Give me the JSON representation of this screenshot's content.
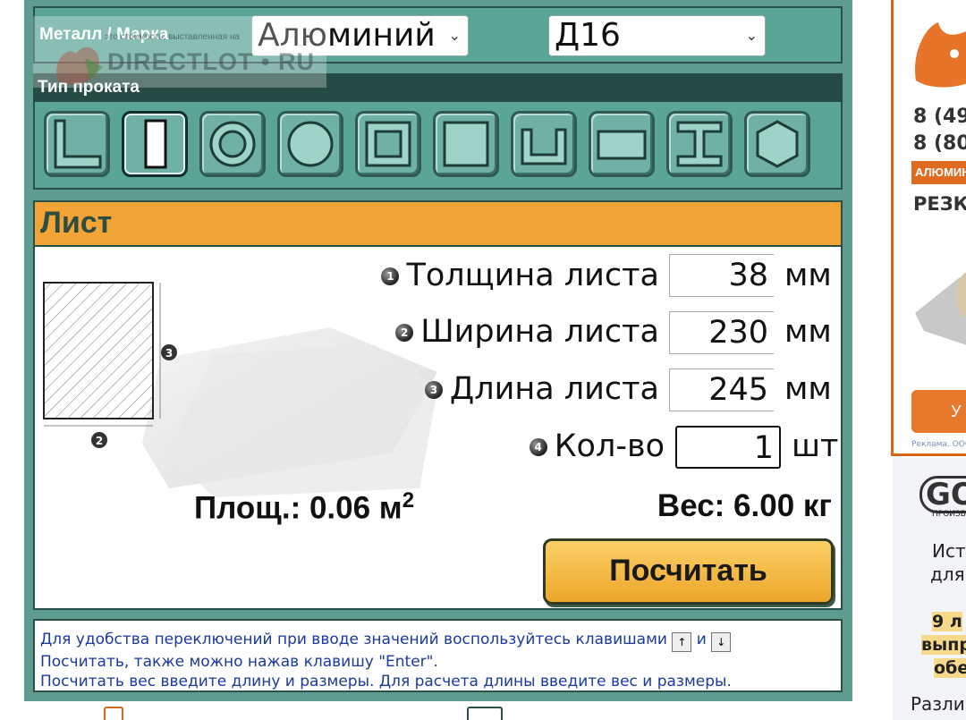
{
  "metal": {
    "label": "Металл / Марка",
    "metal_value": "Алюминий",
    "grade_value": "Д16"
  },
  "watermark": {
    "site": "DIRECTLOT • RU",
    "note": "это стоимость, выставленная на"
  },
  "profile": {
    "label": "Тип проката",
    "shapes": [
      "angle-icon",
      "sheet-icon",
      "pipe-icon",
      "round-bar-icon",
      "square-pipe-icon",
      "square-bar-icon",
      "channel-icon",
      "flat-bar-icon",
      "i-beam-icon",
      "hexagon-icon"
    ],
    "active_index": 1
  },
  "calculator": {
    "title": "Лист",
    "params": [
      {
        "num": "1",
        "label": "Толщина листа",
        "value": "38",
        "unit": "мм"
      },
      {
        "num": "2",
        "label": "Ширина листа",
        "value": "230",
        "unit": "мм"
      },
      {
        "num": "3",
        "label": "Длина листа",
        "value": "245",
        "unit": "мм"
      },
      {
        "num": "4",
        "label": "Кол-во",
        "value": "1",
        "unit": "шт"
      }
    ],
    "diagram_labels": {
      "height": "3",
      "width": "2"
    },
    "area_label": "Площ.: 0.06 м",
    "area_sup": "2",
    "weight_label": "Вес: 6.00 кг",
    "button": "Посчитать"
  },
  "hints": {
    "line1_a": "Для удобства переключений при вводе значений воспользуйтесь клавишами",
    "key_up": "↑",
    "and": "и",
    "key_down": "↓",
    "line2": "Посчитать, также можно нажав клавишу \"Enter\".",
    "line3": "Посчитать вес введите длину и размеры. Для расчета длины введите вес и размеры."
  },
  "ad1": {
    "phone1": "8 (49",
    "phone2": "8 (80",
    "strip": "АЛЮМИНИ",
    "line": "РЕЗК",
    "button": "У",
    "footer": "Реклама. ООО"
  },
  "ad2": {
    "brand": "GO",
    "sub": "ПРОИЗВ",
    "l1": "Ист",
    "l2": "для",
    "h1": "9 л",
    "h2": "выпр",
    "h3": "обе",
    "l3": "Разли"
  },
  "colors": {
    "panel": "#5e9c8f",
    "header_bar": "#264a44",
    "orange": "#f3a436",
    "hint_text": "#1a3aa0",
    "ad_orange": "#e06a1f"
  }
}
